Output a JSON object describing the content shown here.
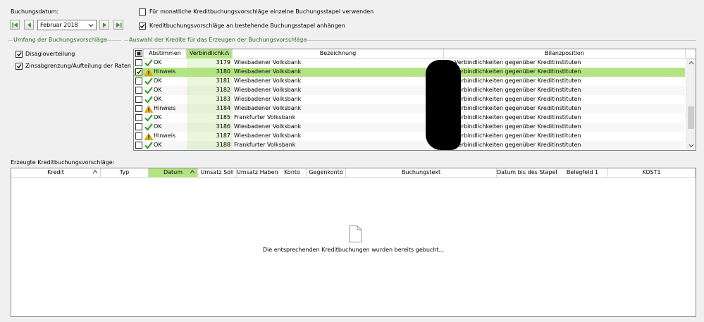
{
  "header": {
    "buchungsdatum_label": "Buchungsdatum:",
    "month_value": "Februar 2018",
    "option1_label": "Für monatliche Kreditbuchungsvorschläge einzelne Buchungsstapel verwenden",
    "option1_checked": false,
    "option2_label": "Kreditbuchungsvorschläge an bestehende Buchungsstapel anhängen",
    "option2_checked": true
  },
  "umfang": {
    "title": "Umfang der Buchungsvorschläge",
    "items": [
      {
        "label": "Disagioverteilung",
        "checked": true
      },
      {
        "label": "Zinsabgrenzung/Aufteilung der Raten",
        "checked": true
      }
    ]
  },
  "auswahl": {
    "title": "Auswahl der Kredite für das Erzeugen der Buchungsvorschläge",
    "columns": [
      "Abstimmen",
      "Verbindlichk...",
      "Bezeichnung",
      "Bilanzposition"
    ],
    "rows": [
      {
        "checked": false,
        "status": "OK",
        "status_icon": "check-icon",
        "nr": "3179",
        "bez": "Wiesbadener Volksbank",
        "bilanz": "Verbindlichkeiten gegenüber Kreditinstituten",
        "selected": false
      },
      {
        "checked": true,
        "status": "Hinweis",
        "status_icon": "warning-icon",
        "nr": "3180",
        "bez": "Wiesbadener Volksbank",
        "bilanz": "Verbindlichkeiten gegenüber Kreditinstituten",
        "selected": true
      },
      {
        "checked": false,
        "status": "OK",
        "status_icon": "check-icon",
        "nr": "3181",
        "bez": "Wiesbadener Volksbank",
        "bilanz": "Verbindlichkeiten gegenüber Kreditinstituten",
        "selected": false
      },
      {
        "checked": false,
        "status": "OK",
        "status_icon": "check-icon",
        "nr": "3182",
        "bez": "Wiesbadener Volksbank",
        "bilanz": "Verbindlichkeiten gegenüber Kreditinstituten",
        "selected": false
      },
      {
        "checked": false,
        "status": "OK",
        "status_icon": "check-icon",
        "nr": "3183",
        "bez": "Wiesbadener Volksbank",
        "bilanz": "Verbindlichkeiten gegenüber Kreditinstituten",
        "selected": false
      },
      {
        "checked": false,
        "status": "Hinweis",
        "status_icon": "warning-icon",
        "nr": "3184",
        "bez": "Wiesbadener Volksbank",
        "bilanz": "Verbindlichkeiten gegenüber Kreditinstituten",
        "selected": false
      },
      {
        "checked": false,
        "status": "OK",
        "status_icon": "check-icon",
        "nr": "3185",
        "bez": "Frankfurter Volksbank",
        "bilanz": "Verbindlichkeiten gegenüber Kreditinstituten",
        "selected": false
      },
      {
        "checked": false,
        "status": "OK",
        "status_icon": "check-icon",
        "nr": "3186",
        "bez": "Wiesbadener Volksbank",
        "bilanz": "Verbindlichkeiten gegenüber Kreditinstituten",
        "selected": false
      },
      {
        "checked": false,
        "status": "Hinweis",
        "status_icon": "warning-icon",
        "nr": "3187",
        "bez": "Wiesbadener Volksbank",
        "bilanz": "Verbindlichkeiten gegenüber Kreditinstituten",
        "selected": false
      },
      {
        "checked": false,
        "status": "OK",
        "status_icon": "check-icon",
        "nr": "3188",
        "bez": "Frankfurter Volksbank",
        "bilanz": "Verbindlichkeiten gegenüber Kreditinstituten",
        "selected": false
      }
    ]
  },
  "erzeugt": {
    "title": "Erzeugte Kreditbuchungsvorschläge:",
    "columns": [
      "Kredit",
      "Typ",
      "Datum",
      "Umsatz Soll",
      "Umsatz Haben",
      "Konto",
      "Gegenkonto",
      "Buchungstext",
      "Datum bis des Stapels",
      "Belegfeld 1",
      "KOST1"
    ],
    "empty_message": "Die entsprechenden Kreditbuchungen wurden bereits gebucht..."
  },
  "colors": {
    "accent_green": "#b4e384",
    "group_title": "#2a6e1c",
    "ok_check": "#2e9a1e",
    "warning": "#f0b400"
  }
}
